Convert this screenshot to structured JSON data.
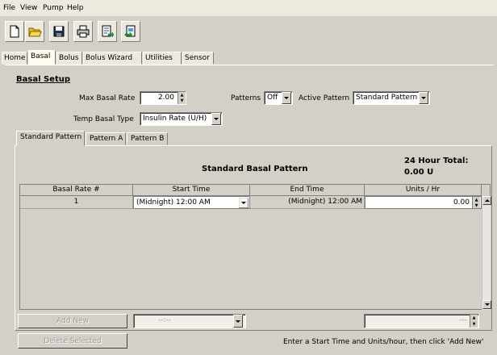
{
  "menu": [
    "File",
    "View",
    "Pump",
    "Help"
  ],
  "toolbar": {
    "icons": [
      "new-file-icon",
      "open-folder-icon",
      "save-icon",
      "print-icon",
      "export-icon",
      "import-icon"
    ]
  },
  "main_tabs": [
    "Home",
    "Basal",
    "Bolus",
    "Bolus Wizard",
    "Utilities",
    "Sensor"
  ],
  "active_main_tab": "Basal",
  "basal_setup": {
    "title": "Basal Setup",
    "max_basal_label": "Max Basal Rate",
    "max_basal_value": "2.00",
    "patterns_label": "Patterns",
    "patterns_value": "Off",
    "active_pattern_label": "Active Pattern",
    "active_pattern_value": "Standard Pattern",
    "temp_basal_label": "Temp Basal Type",
    "temp_basal_value": "Insulin Rate (U/H)"
  },
  "sub_tabs": [
    "Standard Pattern",
    "Pattern A",
    "Pattern B"
  ],
  "pattern": {
    "title": "Standard Basal Pattern",
    "total_label": "24 Hour Total:",
    "total_value": "0.00 U"
  },
  "grid": {
    "headers": [
      "Basal Rate #",
      "Start Time",
      "End Time",
      "Units / Hr"
    ],
    "rows": [
      {
        "num": "1",
        "start": "(Midnight) 12:00 AM",
        "end": "(Midnight) 12:00 AM",
        "units": "0.00"
      }
    ]
  },
  "footer": {
    "add_new": "Add New",
    "delete_selected": "Delete Selected",
    "time_placeholder": "--:--",
    "units_placeholder": "---",
    "hint": "Enter a Start Time and Units/hour, then click 'Add New'"
  },
  "colors": {
    "face": "#d4d0c8",
    "active_tab": "#fffdf0"
  }
}
